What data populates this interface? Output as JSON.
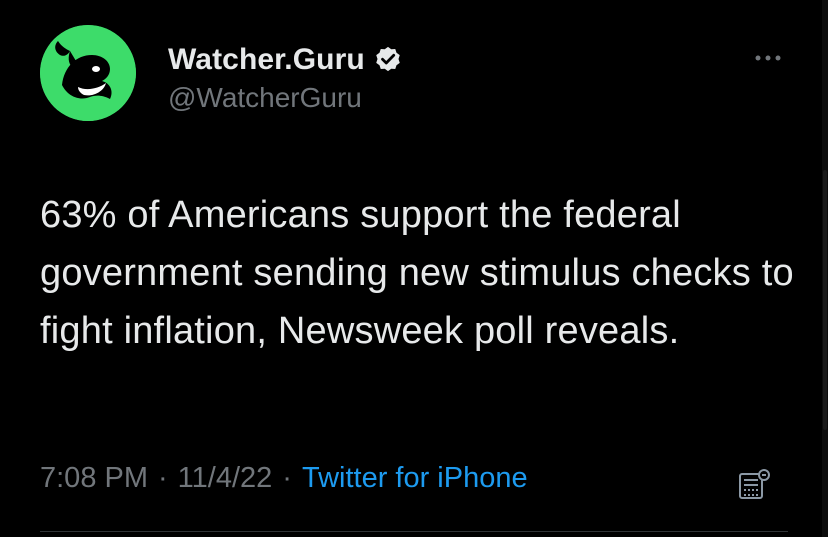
{
  "tweet": {
    "author": {
      "display_name": "Watcher.Guru",
      "handle": "@WatcherGuru",
      "avatar_icon": "whale-logo-icon",
      "avatar_color": "#3ddc6a",
      "verified_icon": "verified-badge-icon"
    },
    "text": "63% of Americans support the federal government sending new stimulus checks to fight inflation, Newsweek poll reveals.",
    "time": "7:08 PM",
    "separator": "·",
    "date": "11/4/22",
    "source": "Twitter for iPhone",
    "more_icon": "more-options-icon",
    "analytics_icon": "analytics-icon"
  },
  "colors": {
    "background": "#000000",
    "primary_text": "#e7e9ea",
    "secondary_text": "#71767b",
    "link": "#1d9bf0",
    "divider": "#2f3336"
  }
}
